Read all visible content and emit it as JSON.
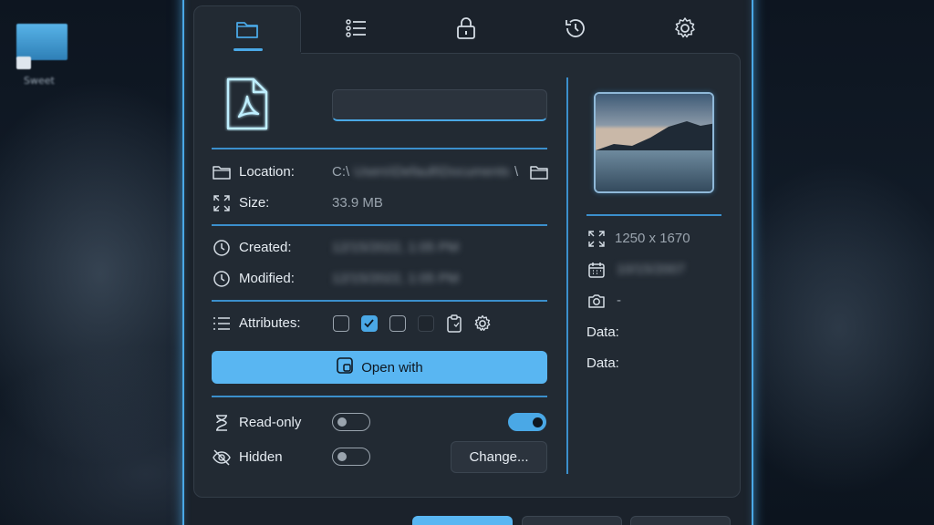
{
  "desktop": {
    "icon_label": "Sweet"
  },
  "tabs": [
    {
      "name": "general",
      "icon": "folder-icon"
    },
    {
      "name": "details",
      "icon": "list-icon"
    },
    {
      "name": "security",
      "icon": "lock-icon"
    },
    {
      "name": "previous-versions",
      "icon": "history-icon"
    },
    {
      "name": "settings",
      "icon": "gear-icon"
    }
  ],
  "file": {
    "type_icon": "pdf-file-icon",
    "name_value": ""
  },
  "location": {
    "label": "Location:",
    "prefix": "C:\\",
    "path_blurred": "Users\\Default\\Documents\\Sweet",
    "suffix": "\\"
  },
  "size": {
    "label": "Size:",
    "value": "33.9 MB"
  },
  "created": {
    "label": "Created:",
    "value": "12/15/2022, 1:05 PM"
  },
  "modified": {
    "label": "Modified:",
    "value": "12/15/2022, 1:05 PM"
  },
  "attributes": {
    "label": "Attributes:"
  },
  "open_with": {
    "label": "Open with"
  },
  "readonly": {
    "label": "Read-only"
  },
  "hidden": {
    "label": "Hidden"
  },
  "change_button": {
    "label": "Change..."
  },
  "image_info": {
    "dimensions": "1250 x 1670",
    "date_blurred": "10/15/2007",
    "camera": "-",
    "data1_label": "Data:",
    "data2_label": "Data:"
  },
  "colors": {
    "accent": "#4aa8e6",
    "button": "#59b6f2",
    "panel": "#222a33"
  }
}
